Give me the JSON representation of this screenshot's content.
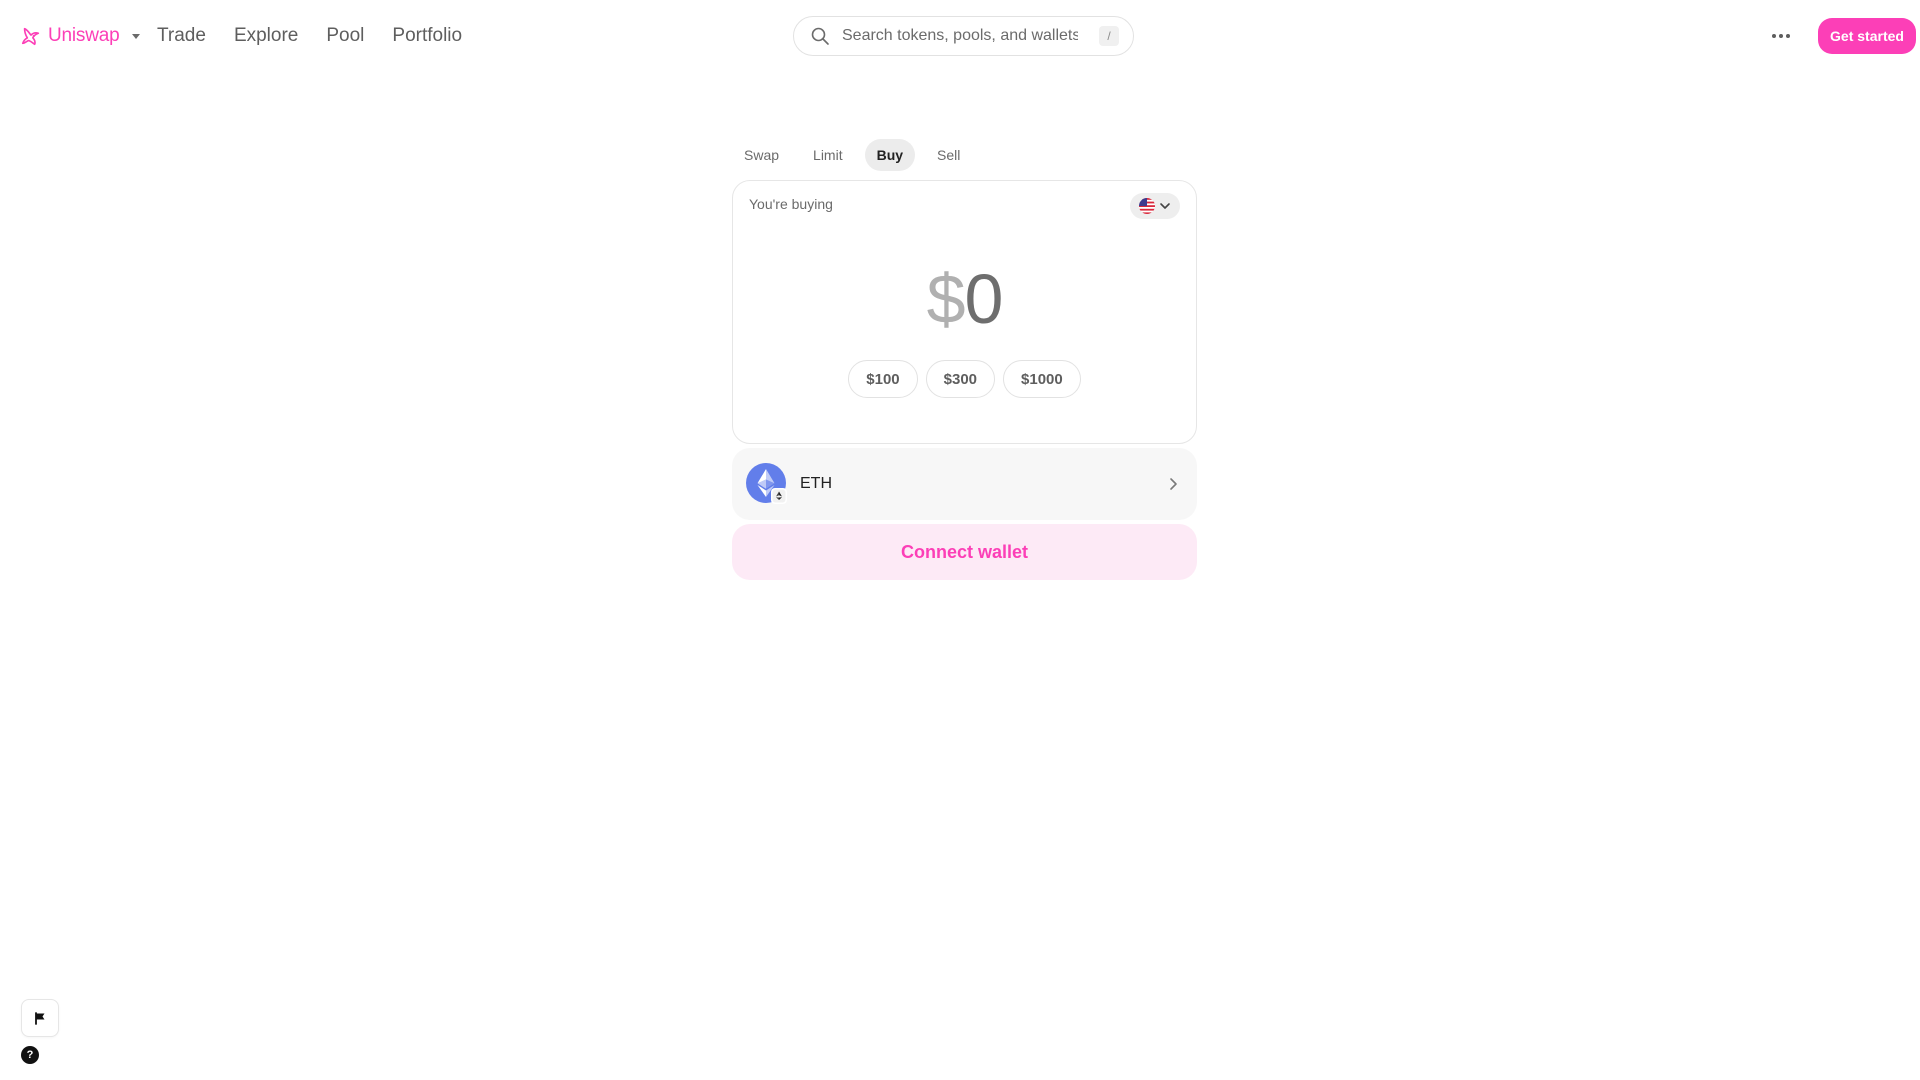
{
  "brand": {
    "name": "Uniswap",
    "color": "#FC3FB7"
  },
  "nav": {
    "links": [
      "Trade",
      "Explore",
      "Pool",
      "Portfolio"
    ]
  },
  "search": {
    "placeholder": "Search tokens, pools, and wallets",
    "shortcut": "/"
  },
  "header": {
    "get_started": "Get started"
  },
  "widget": {
    "tabs": [
      {
        "label": "Swap"
      },
      {
        "label": "Limit"
      },
      {
        "label": "Buy"
      },
      {
        "label": "Sell"
      }
    ],
    "active_tab": "Buy",
    "buying_label": "You're buying",
    "country_icon": "us-flag-icon",
    "amount_prefix": "$",
    "amount_value": "0",
    "presets": [
      "$100",
      "$300",
      "$1000"
    ],
    "token": {
      "symbol": "ETH",
      "icon": "eth-icon"
    },
    "connect_wallet": "Connect wallet"
  },
  "footer": {
    "help_glyph": "?"
  }
}
